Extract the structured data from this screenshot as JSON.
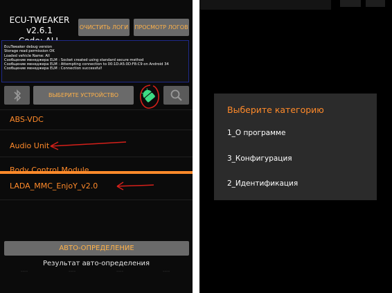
{
  "left_screen": {
    "app_title_line1": "ECU-TWEAKER v2.6.1",
    "app_title_line2": "Code: ALL",
    "clear_logs_label": "ОЧИСТИТЬ ЛОГИ",
    "view_logs_label": "ПРОСМОТР ЛОГОВ",
    "log_lines": [
      "EcuTweaker debug version",
      "Storage read permission OK",
      "Loaded vehicle Name: All",
      "Сообщение менеджера ELM : Socket created using standard secure method",
      "Сообщение менеджера ELM : Attempting connection to 00:1D:A5:0D:F8:C9 on Android 34",
      "Сообщение менеджера ELM : Connection successful!"
    ],
    "select_device_label": "ВЫБЕРИТЕ УСТРОЙСТВО",
    "list_items": [
      "ABS-VDC",
      "Audio Unit",
      "Body Control Module",
      "LADA_MMC_EnjoY_v2.0"
    ],
    "auto_detect_label": "АВТО-ОПРЕДЕЛЕНИЕ",
    "auto_detect_result_label": "Результат авто-определения",
    "result_placeholders": [
      "----",
      "----",
      "----",
      "----"
    ]
  },
  "right_screen": {
    "dialog_title": "Выберите категорию",
    "options": [
      "1_О программе",
      "3_Конфигурация",
      "2_Идентификация"
    ]
  },
  "colors": {
    "accent_orange": "#ff8a2a",
    "button_gray": "#6a6a6a",
    "annotation_red": "#d6201a",
    "android_green": "#3ddc84"
  },
  "icons": [
    "bluetooth-icon",
    "android-icon",
    "search-icon"
  ]
}
